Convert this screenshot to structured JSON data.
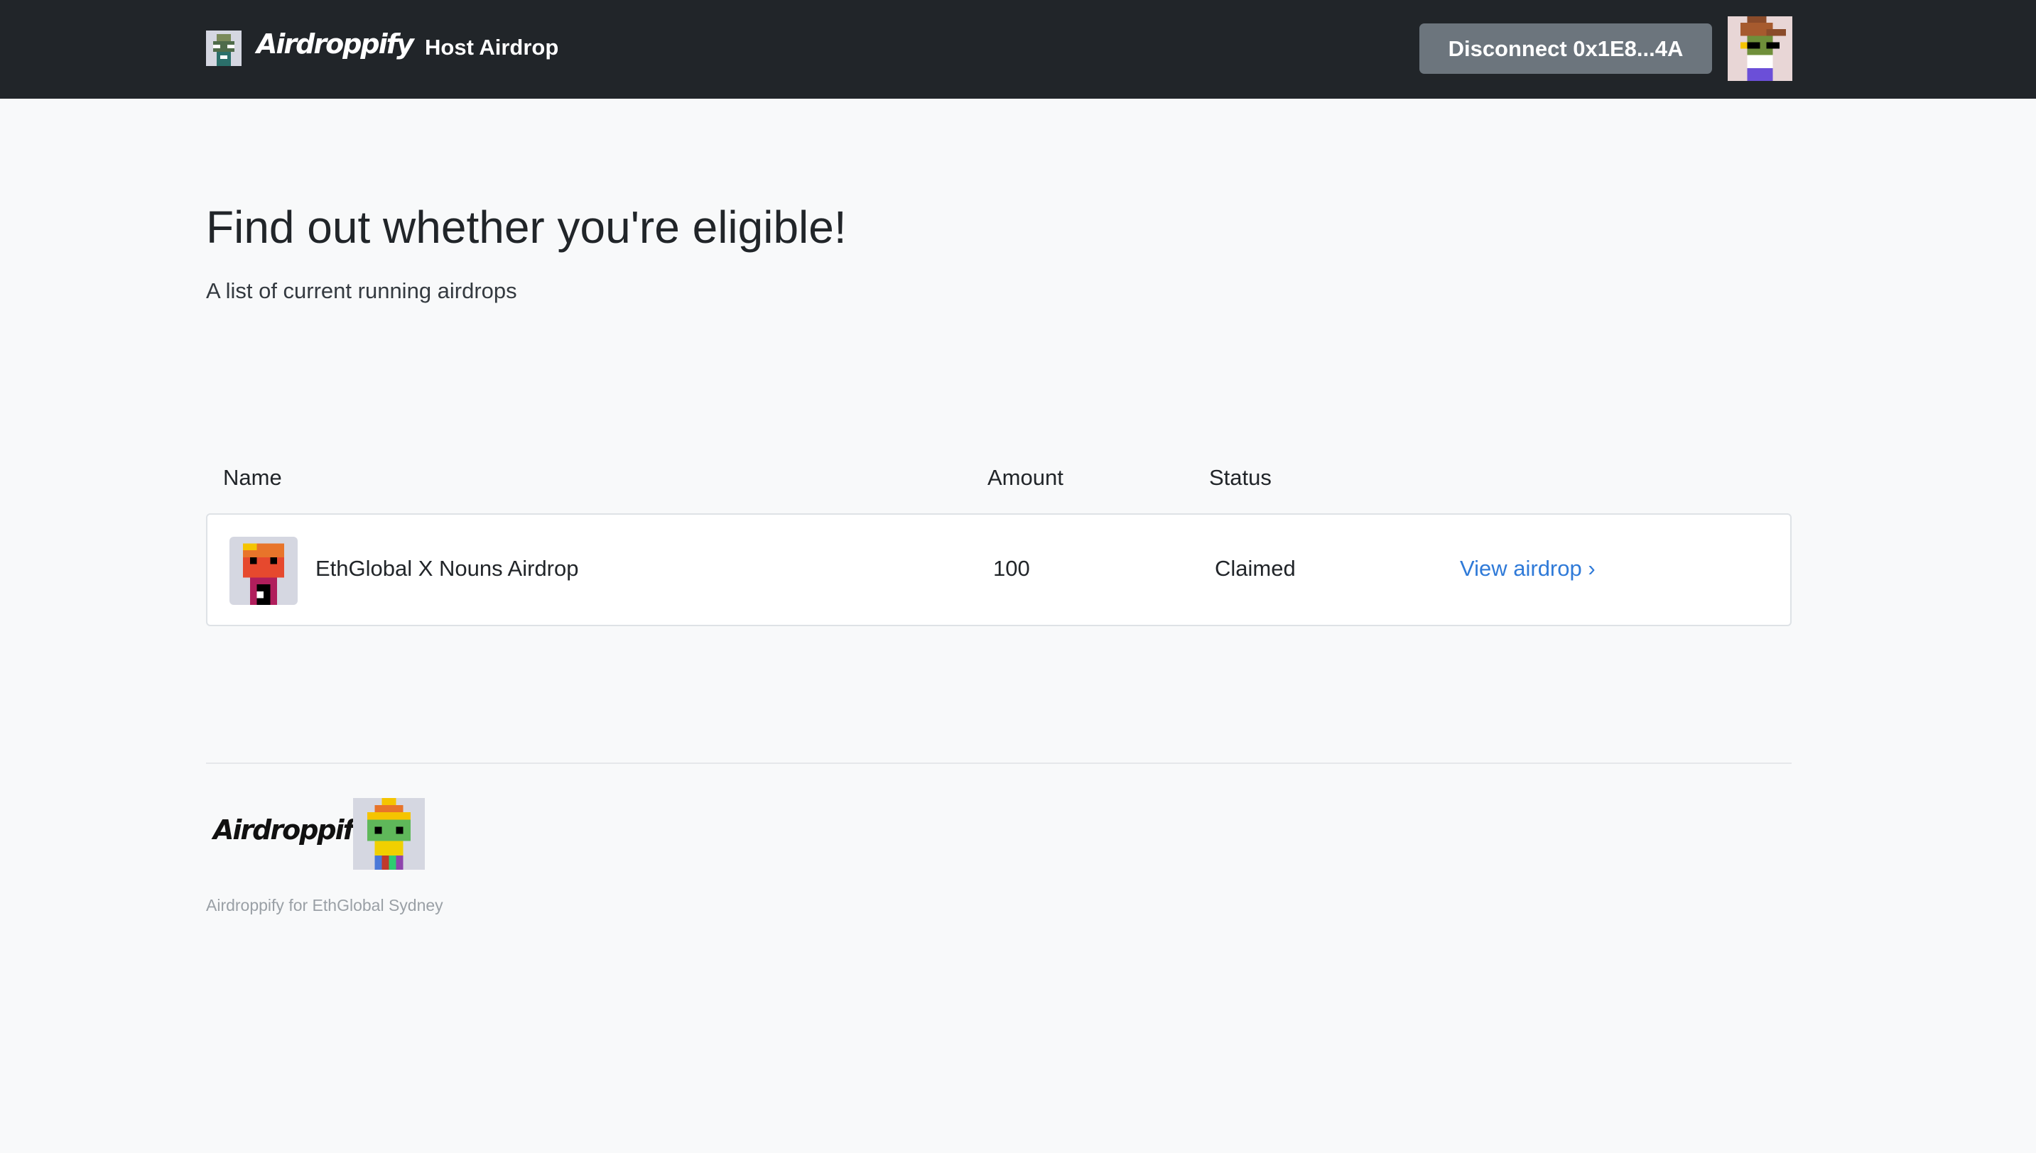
{
  "nav": {
    "brand": "Airdroppify",
    "host_link": "Host Airdrop",
    "disconnect_label": "Disconnect 0x1E8...4A"
  },
  "hero": {
    "title": "Find out whether you're eligible!",
    "subtitle": "A list of current running airdrops"
  },
  "table": {
    "headers": [
      "Name",
      "Amount",
      "Status"
    ],
    "rows": [
      {
        "name": "EthGlobal X Nouns Airdrop",
        "amount": "100",
        "status": "Claimed",
        "action": "View airdrop ›"
      }
    ]
  },
  "footer": {
    "brand": "Airdroppify",
    "text": "Airdroppify for EthGlobal Sydney"
  },
  "colors": {
    "navbar": "#212529",
    "button": "#6c757d",
    "link": "#2f7ad8"
  },
  "icons": [
    "nav-logo-noun-icon",
    "user-avatar-noun-icon",
    "airdrop-noun-icon",
    "footer-noun-icon"
  ]
}
